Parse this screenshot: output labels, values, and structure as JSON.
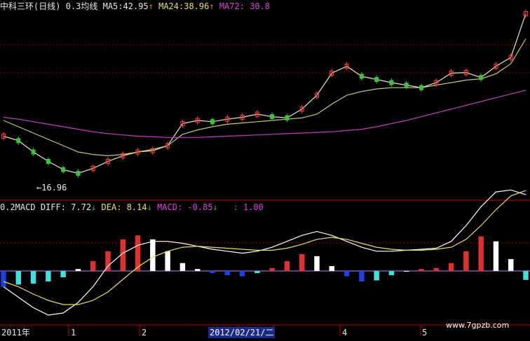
{
  "header": {
    "title": "中科三环(日线)",
    "avg_label": "0.3均线",
    "ma5_label": "MA5:",
    "ma5_value": "42.95",
    "ma5_arrow": "↑",
    "ma24_label": "MA24:",
    "ma24_value": "38.96",
    "ma24_arrow": "↑",
    "ma72_label": "MA72:",
    "ma72_value": "30.8"
  },
  "low_marker": "16.96",
  "macd_header": {
    "prefix": "0.2MACD",
    "diff_label": "DIFF:",
    "diff_value": "7.72",
    "diff_arrow": "↓",
    "dea_label": "DEA:",
    "dea_value": "8.14",
    "dea_arrow": "↓",
    "macd_label": "MACD:",
    "macd_value": "-0.85",
    "macd_arrow": "↓",
    "extra_label": ":",
    "extra_value": "1.00"
  },
  "x_axis": {
    "labels": [
      "2011年",
      "1",
      "2",
      "2012/02/21/二",
      "4",
      "5"
    ]
  },
  "watermark": "www.7gpzb.com",
  "colors": {
    "ma5": "#e8e8c0",
    "ma24": "#c8c870",
    "ma72": "#c040c0",
    "ma_long": "#40c0c0",
    "up_candle": "#ff4040",
    "down_candle": "#40c040",
    "macd_pos": "#e03030",
    "macd_pos_light": "#ffffff",
    "macd_neg": "#2040e0",
    "macd_neg_light": "#40e0e0",
    "divider": "#c00000",
    "baseline": "#c080ff"
  },
  "chart_data": [
    {
      "type": "line",
      "title": "中科三环(日线)",
      "series": [
        {
          "name": "MA5",
          "values": [
            23.5,
            22.8,
            21.0,
            19.5,
            18.2,
            17.6,
            18.4,
            19.5,
            20.4,
            21.0,
            21.2,
            22.0,
            25.5,
            26.0,
            25.8,
            26.2,
            26.5,
            27.0,
            26.6,
            26.4,
            27.8,
            30.0,
            33.5,
            34.6,
            33.0,
            32.5,
            32.0,
            31.6,
            31.2,
            32.0,
            33.5,
            33.6,
            32.8,
            34.6,
            36.0,
            42.95
          ]
        },
        {
          "name": "MA24",
          "values": [
            26.0,
            25.0,
            24.0,
            23.0,
            22.0,
            21.0,
            20.6,
            20.4,
            20.6,
            21.0,
            21.4,
            22.0,
            23.8,
            24.5,
            25.0,
            25.4,
            25.6,
            25.8,
            26.0,
            26.2,
            26.4,
            27.0,
            28.6,
            30.0,
            30.6,
            31.0,
            31.2,
            31.2,
            31.2,
            31.6,
            32.0,
            32.4,
            32.6,
            33.4,
            35.0,
            38.96
          ]
        },
        {
          "name": "MA72",
          "values": [
            26.5,
            26.2,
            25.8,
            25.4,
            25.0,
            24.6,
            24.2,
            23.9,
            23.7,
            23.5,
            23.4,
            23.3,
            23.3,
            23.3,
            23.4,
            23.5,
            23.6,
            23.7,
            23.8,
            23.9,
            24.0,
            24.1,
            24.2,
            24.4,
            24.6,
            25.0,
            25.5,
            26.0,
            26.6,
            27.2,
            27.8,
            28.4,
            29.0,
            29.6,
            30.2,
            30.8
          ]
        }
      ]
    },
    {
      "type": "bar",
      "title": "MACD",
      "series": [
        {
          "name": "DIFF",
          "values": [
            -1.5,
            -2.5,
            -3.5,
            -4.2,
            -4.0,
            -3.0,
            -1.5,
            0.5,
            1.8,
            2.6,
            3.0,
            3.0,
            2.8,
            2.5,
            2.2,
            2.0,
            1.8,
            2.0,
            2.4,
            3.0,
            3.6,
            4.0,
            3.6,
            3.0,
            2.4,
            2.0,
            2.0,
            2.1,
            2.2,
            2.3,
            3.0,
            4.6,
            6.5,
            8.0,
            8.2,
            7.72
          ]
        },
        {
          "name": "DEA",
          "values": [
            -1.0,
            -1.5,
            -2.2,
            -2.8,
            -3.2,
            -3.2,
            -2.8,
            -2.0,
            -0.8,
            0.4,
            1.4,
            2.0,
            2.4,
            2.5,
            2.4,
            2.3,
            2.2,
            2.1,
            2.1,
            2.3,
            2.7,
            3.2,
            3.4,
            3.2,
            2.8,
            2.4,
            2.2,
            2.1,
            2.1,
            2.2,
            2.4,
            3.2,
            4.6,
            6.2,
            7.6,
            8.14
          ]
        },
        {
          "name": "MACD",
          "values": [
            -1.5,
            -1.3,
            -1.2,
            -1.0,
            -0.6,
            0.2,
            1.0,
            2.0,
            3.2,
            3.6,
            3.2,
            2.0,
            0.8,
            0.2,
            -0.2,
            -0.4,
            -0.5,
            -0.2,
            0.3,
            1.0,
            1.7,
            1.5,
            0.5,
            -0.5,
            -1.0,
            -0.9,
            -0.4,
            0.0,
            0.2,
            0.3,
            0.8,
            2.0,
            3.5,
            3.0,
            1.2,
            -0.85
          ]
        }
      ],
      "ylim": [
        -5,
        9
      ]
    }
  ]
}
